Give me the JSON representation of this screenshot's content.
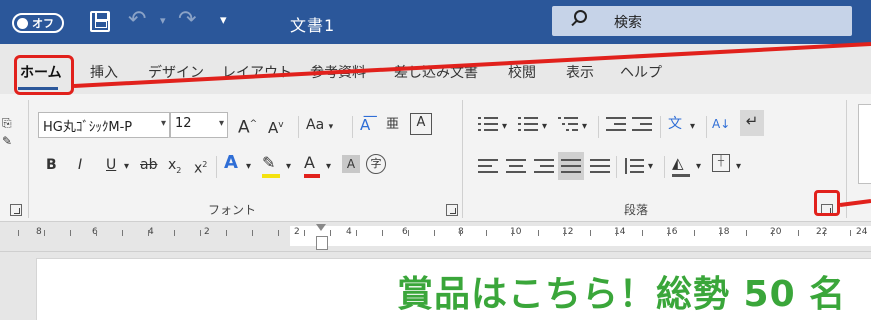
{
  "titlebar": {
    "autosave_label": "オフ",
    "document_title": "文書1",
    "search_placeholder": "検索"
  },
  "tabs": [
    {
      "label": "ホーム",
      "active": true
    },
    {
      "label": "挿入"
    },
    {
      "label": "デザイン"
    },
    {
      "label": "レイアウト"
    },
    {
      "label": "参考資料"
    },
    {
      "label": "差し込み文書"
    },
    {
      "label": "校閲"
    },
    {
      "label": "表示"
    },
    {
      "label": "ヘルプ"
    }
  ],
  "font_group": {
    "font_name": "HG丸ｺﾞｼｯｸM-P",
    "font_size": "12",
    "grow_font": "A",
    "shrink_font": "A",
    "change_case": "Aa",
    "phonetic_guide": "亜",
    "char_border": "A",
    "bold": "B",
    "italic": "I",
    "underline": "U",
    "strikethrough": "ab",
    "subscript": "x",
    "superscript": "x",
    "text_effects": "A",
    "font_color": "A",
    "char_shading": "A",
    "enclose_char": "字",
    "label": "フォント"
  },
  "paragraph_group": {
    "sort": "A↓",
    "label": "段落"
  },
  "ruler": {
    "numbers": [
      "8",
      "6",
      "4",
      "2",
      "2",
      "4",
      "6",
      "8",
      "10",
      "12",
      "14",
      "16",
      "18",
      "20",
      "22",
      "24"
    ]
  },
  "document": {
    "heading": "賞品はこちら！総勢 50 名"
  },
  "colors": {
    "titlebar_bg": "#2b579a",
    "annotation": "#e1211c",
    "heading_green": "#3aa63a",
    "font_color_red": "#e1211c",
    "highlight_yellow": "#f4e20f",
    "text_effect_blue": "#2f6ed6"
  }
}
